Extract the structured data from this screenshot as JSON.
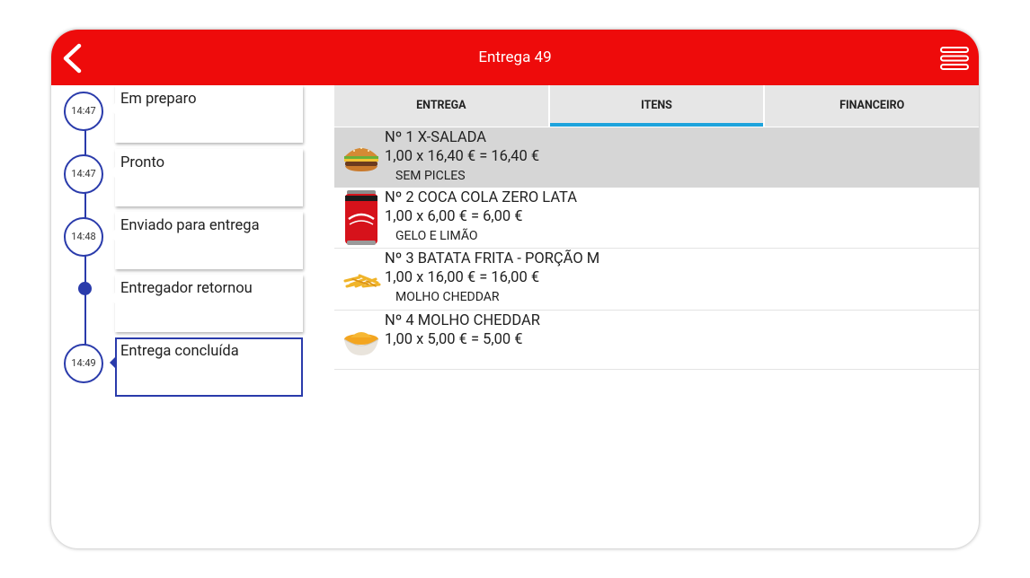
{
  "header": {
    "title": "Entrega 49"
  },
  "timeline": [
    {
      "time": "14:47",
      "label": "Em preparo"
    },
    {
      "time": "14:47",
      "label": "Pronto"
    },
    {
      "time": "14:48",
      "label": "Enviado para entrega"
    },
    {
      "time": "",
      "label": "Entregador retornou"
    },
    {
      "time": "14:49",
      "label": "Entrega concluída"
    }
  ],
  "tabs": [
    "ENTREGA",
    "ITENS",
    "FINANCEIRO"
  ],
  "active_tab": "ITENS",
  "items": [
    {
      "name": "Nº 1 X-SALADA",
      "qty": "1,00 x 16,40 € = 16,40 €",
      "note": "SEM PICLES",
      "icon": "burger-icon"
    },
    {
      "name": "Nº 2 COCA COLA ZERO LATA",
      "qty": "1,00 x 6,00 € = 6,00 €",
      "note": "GELO E LIMÃO",
      "icon": "soda-can-icon"
    },
    {
      "name": "Nº 3 BATATA FRITA - PORÇÃO M",
      "qty": "1,00 x 16,00 € = 16,00 €",
      "note": "MOLHO CHEDDAR",
      "icon": "fries-icon"
    },
    {
      "name": "Nº 4 MOLHO CHEDDAR",
      "qty": "1,00 x 5,00 € = 5,00 €",
      "note": "",
      "icon": "sauce-bowl-icon"
    }
  ],
  "colors": {
    "header": "#ee0b0b",
    "timeline": "#2a3bab",
    "tab_indicator": "#1ea3dc",
    "selected_row": "#d6d6d6"
  }
}
